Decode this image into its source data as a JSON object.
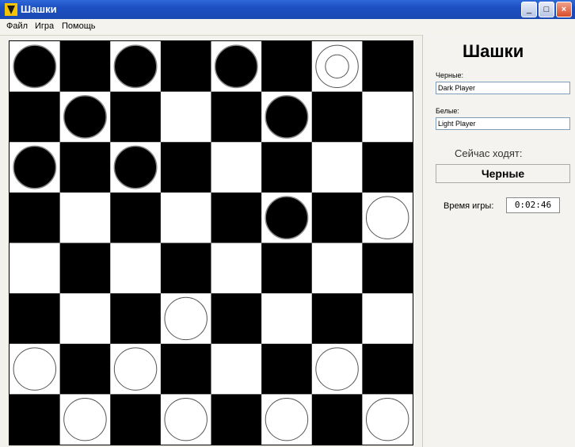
{
  "window": {
    "title": "Шашки"
  },
  "menu": [
    "Файл",
    "Игра",
    "Помощь"
  ],
  "panel": {
    "game_title": "Шашки",
    "black_label": "Черные:",
    "black_player": "Dark Player",
    "white_label": "Белые:",
    "white_player": "Light Player",
    "turn_label": "Сейчас ходят:",
    "turn_value": "Черные",
    "time_label": "Время игры:",
    "time_value": "0:02:46"
  },
  "board": {
    "size": 8,
    "top_left_color": "white",
    "light_square_color": "#ffffff",
    "dark_square_color": "#000000",
    "pieces": [
      {
        "row": 0,
        "col": 0,
        "color": "black"
      },
      {
        "row": 0,
        "col": 2,
        "color": "black"
      },
      {
        "row": 0,
        "col": 4,
        "color": "black"
      },
      {
        "row": 0,
        "col": 6,
        "color": "white",
        "king": true
      },
      {
        "row": 1,
        "col": 1,
        "color": "black"
      },
      {
        "row": 1,
        "col": 5,
        "color": "black"
      },
      {
        "row": 2,
        "col": 0,
        "color": "black"
      },
      {
        "row": 2,
        "col": 2,
        "color": "black"
      },
      {
        "row": 3,
        "col": 5,
        "color": "black"
      },
      {
        "row": 3,
        "col": 7,
        "color": "white"
      },
      {
        "row": 5,
        "col": 3,
        "color": "white"
      },
      {
        "row": 6,
        "col": 0,
        "color": "white"
      },
      {
        "row": 6,
        "col": 2,
        "color": "white"
      },
      {
        "row": 6,
        "col": 6,
        "color": "white"
      },
      {
        "row": 7,
        "col": 1,
        "color": "white"
      },
      {
        "row": 7,
        "col": 3,
        "color": "white"
      },
      {
        "row": 7,
        "col": 5,
        "color": "white"
      },
      {
        "row": 7,
        "col": 7,
        "color": "white"
      }
    ]
  }
}
